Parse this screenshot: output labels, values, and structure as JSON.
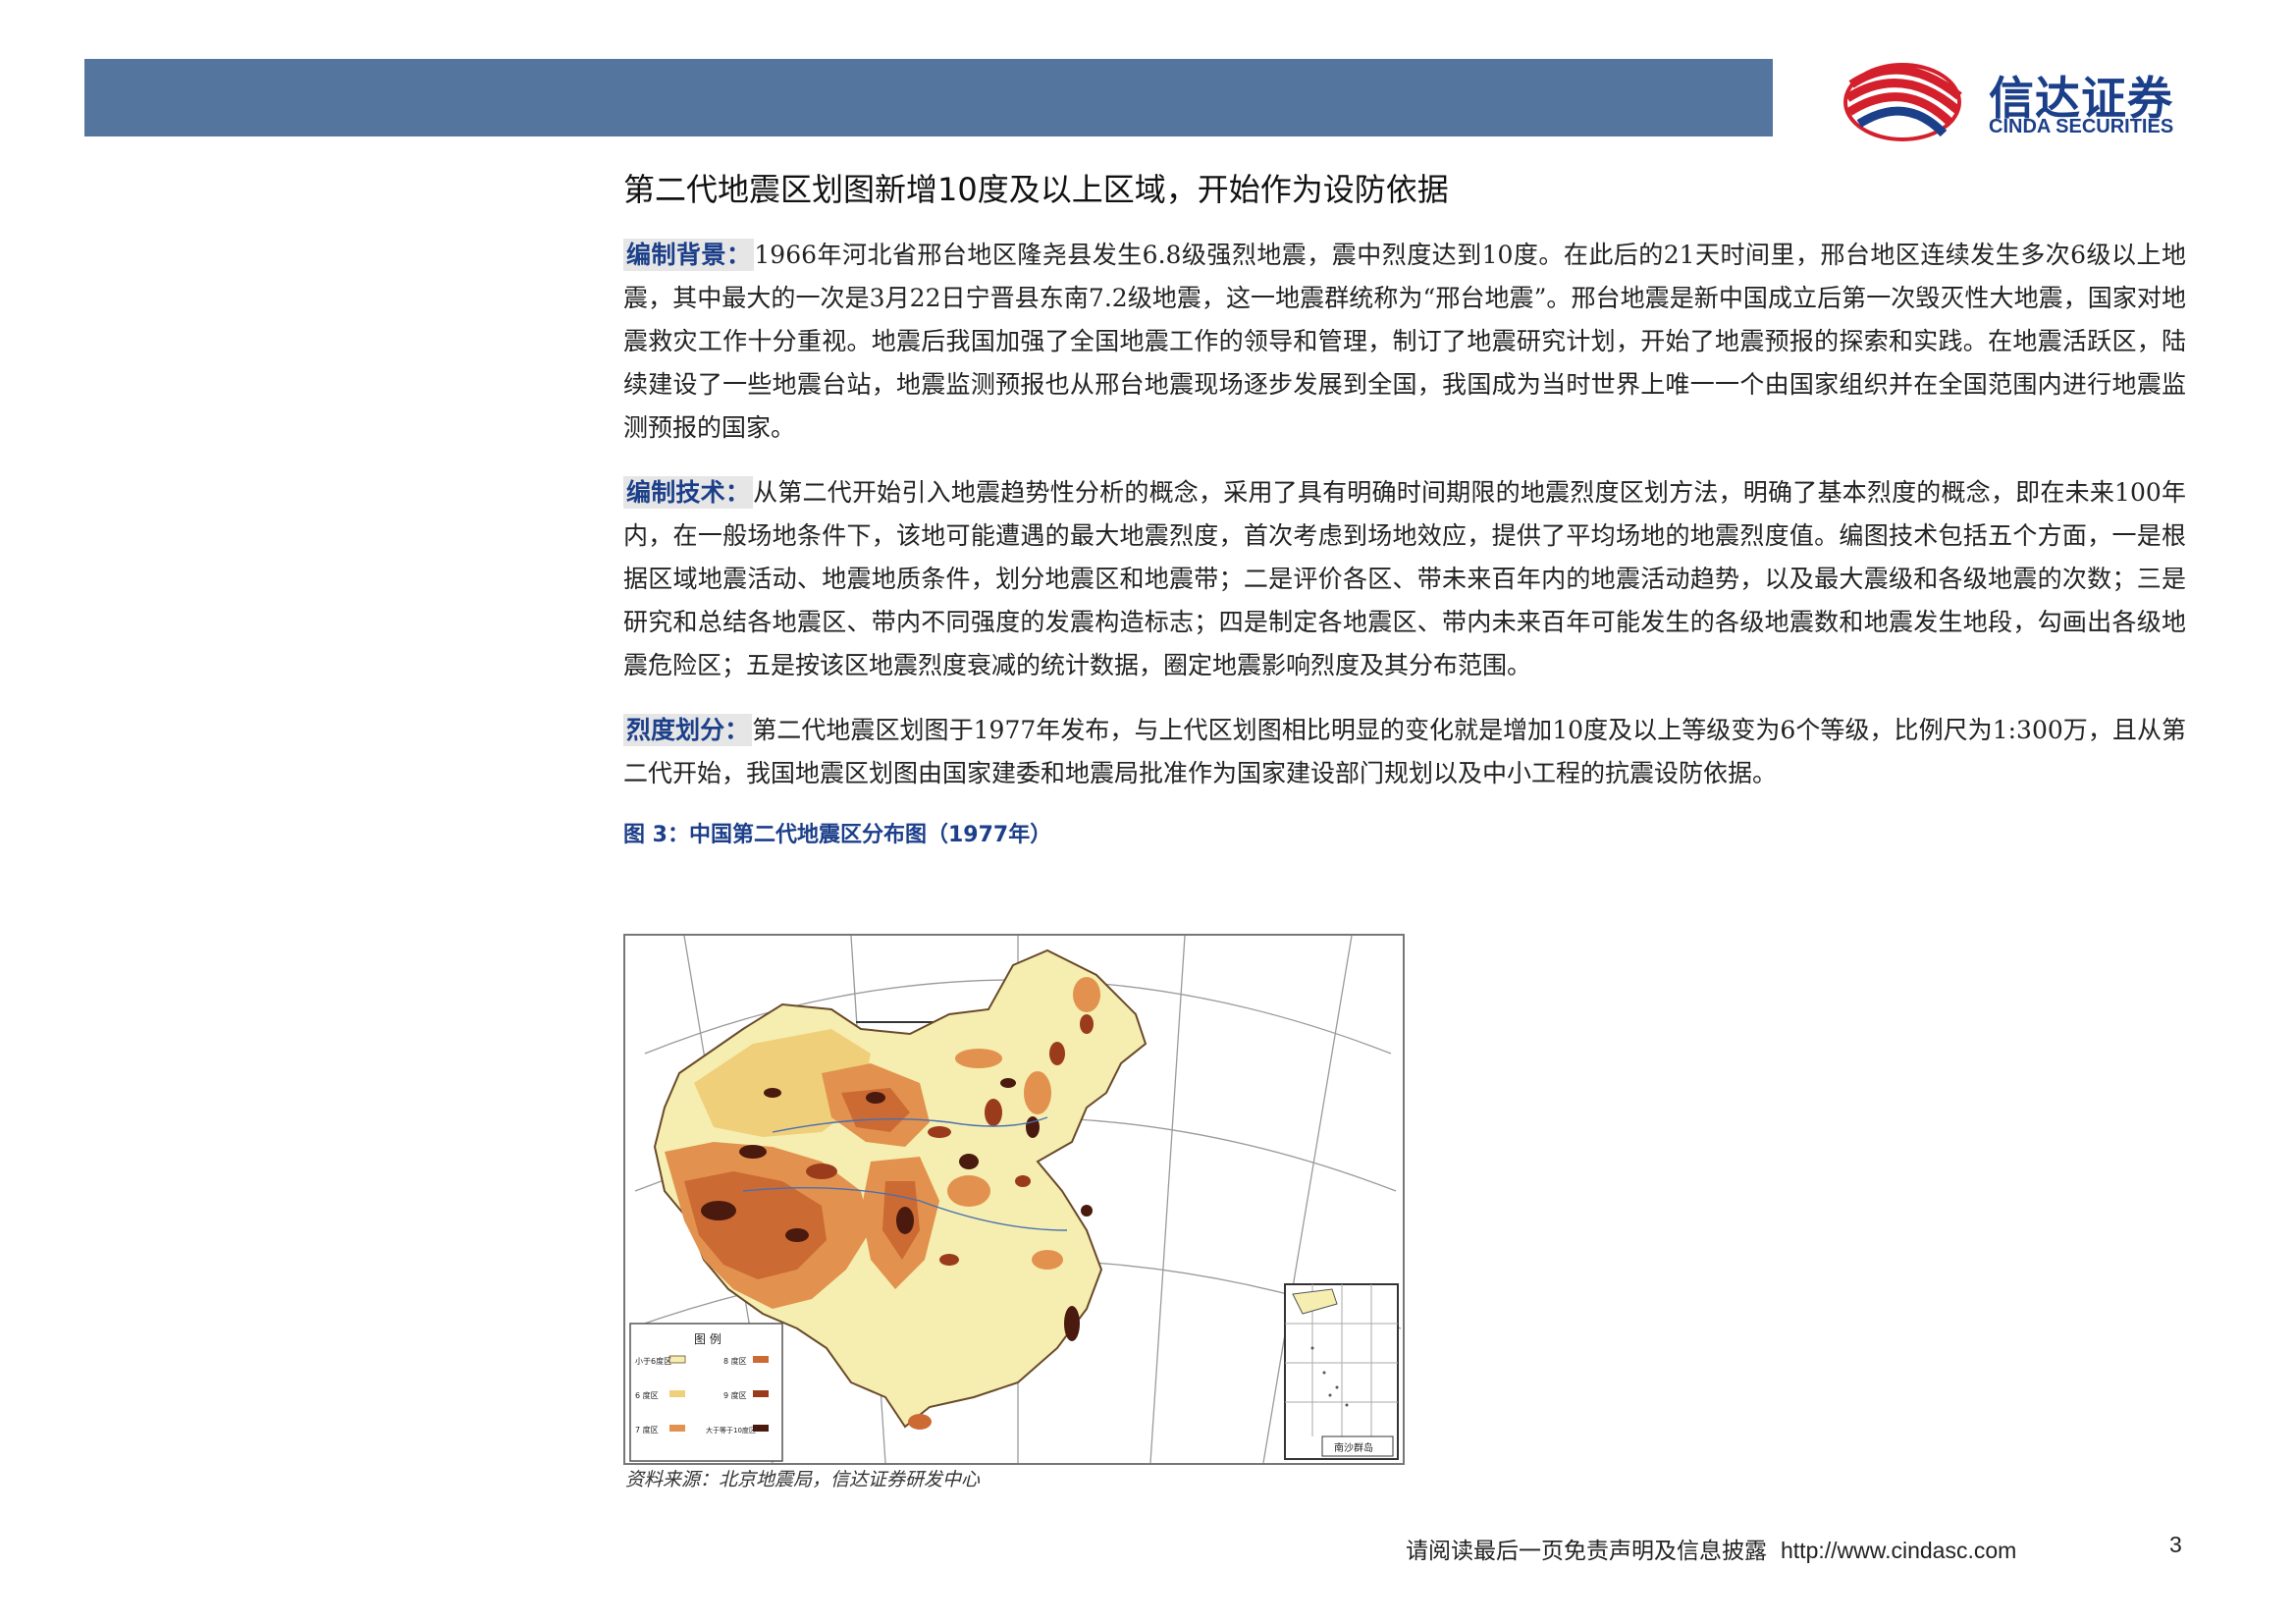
{
  "header": {
    "logo_cn": "信达证券",
    "logo_en": "CINDA SECURITIES"
  },
  "section": {
    "title": "第二代地震区划图新增10度及以上区域，开始作为设防依据"
  },
  "paragraphs": [
    {
      "label": "编制背景：",
      "text": "1966年河北省邢台地区隆尧县发生6.8级强烈地震，震中烈度达到10度。在此后的21天时间里，邢台地区连续发生多次6级以上地震，其中最大的一次是3月22日宁晋县东南7.2级地震，这一地震群统称为“邢台地震”。邢台地震是新中国成立后第一次毁灭性大地震，国家对地震救灾工作十分重视。地震后我国加强了全国地震工作的领导和管理，制订了地震研究计划，开始了地震预报的探索和实践。在地震活跃区，陆续建设了一些地震台站，地震监测预报也从邢台地震现场逐步发展到全国，我国成为当时世界上唯一一个由国家组织并在全国范围内进行地震监测预报的国家。"
    },
    {
      "label": "编制技术：",
      "text": "从第二代开始引入地震趋势性分析的概念，采用了具有明确时间期限的地震烈度区划方法，明确了基本烈度的概念，即在未来100年内，在一般场地条件下，该地可能遭遇的最大地震烈度，首次考虑到场地效应，提供了平均场地的地震烈度值。编图技术包括五个方面，一是根据区域地震活动、地震地质条件，划分地震区和地震带；二是评价各区、带未来百年内的地震活动趋势，以及最大震级和各级地震的次数；三是研究和总结各地震区、带内不同强度的发震构造标志；四是制定各地震区、带内未来百年可能发生的各级地震数和地震发生地段，勾画出各级地震危险区；五是按该区地震烈度衰减的统计数据，圈定地震影响烈度及其分布范围。"
    },
    {
      "label": "烈度划分：",
      "text": "第二代地震区划图于1977年发布，与上代区划图相比明显的变化就是增加10度及以上等级变为6个等级，比例尺为1:300万，且从第二代开始，我国地震区划图由国家建委和地震局批准作为国家建设部门规划以及中小工程的抗震设防依据。"
    }
  ],
  "figure": {
    "caption": "图 3：中国第二代地震区分布图（1977年）",
    "legend_title": "图 例",
    "legend_items": [
      "小于6度区",
      "8 度区",
      "6 度区",
      "9 度区",
      "7 度区",
      "大于等于10度区"
    ],
    "inset_label": "南沙群岛",
    "source": "资料来源：北京地震局，信达证券研发中心"
  },
  "footer": {
    "disclaimer": "请阅读最后一页免责声明及信息披露",
    "url": "http://www.cindasc.com",
    "page": "3"
  },
  "colors": {
    "header_bar": "#53759e",
    "brand_blue": "#1c3f8a",
    "brand_red": "#d4202c",
    "zone_lt6": "#f5eeb0",
    "zone_6": "#efcf7a",
    "zone_7": "#e2924e",
    "zone_8": "#cc6a33",
    "zone_9": "#9a3c1c",
    "zone_10": "#4a1a0e"
  }
}
